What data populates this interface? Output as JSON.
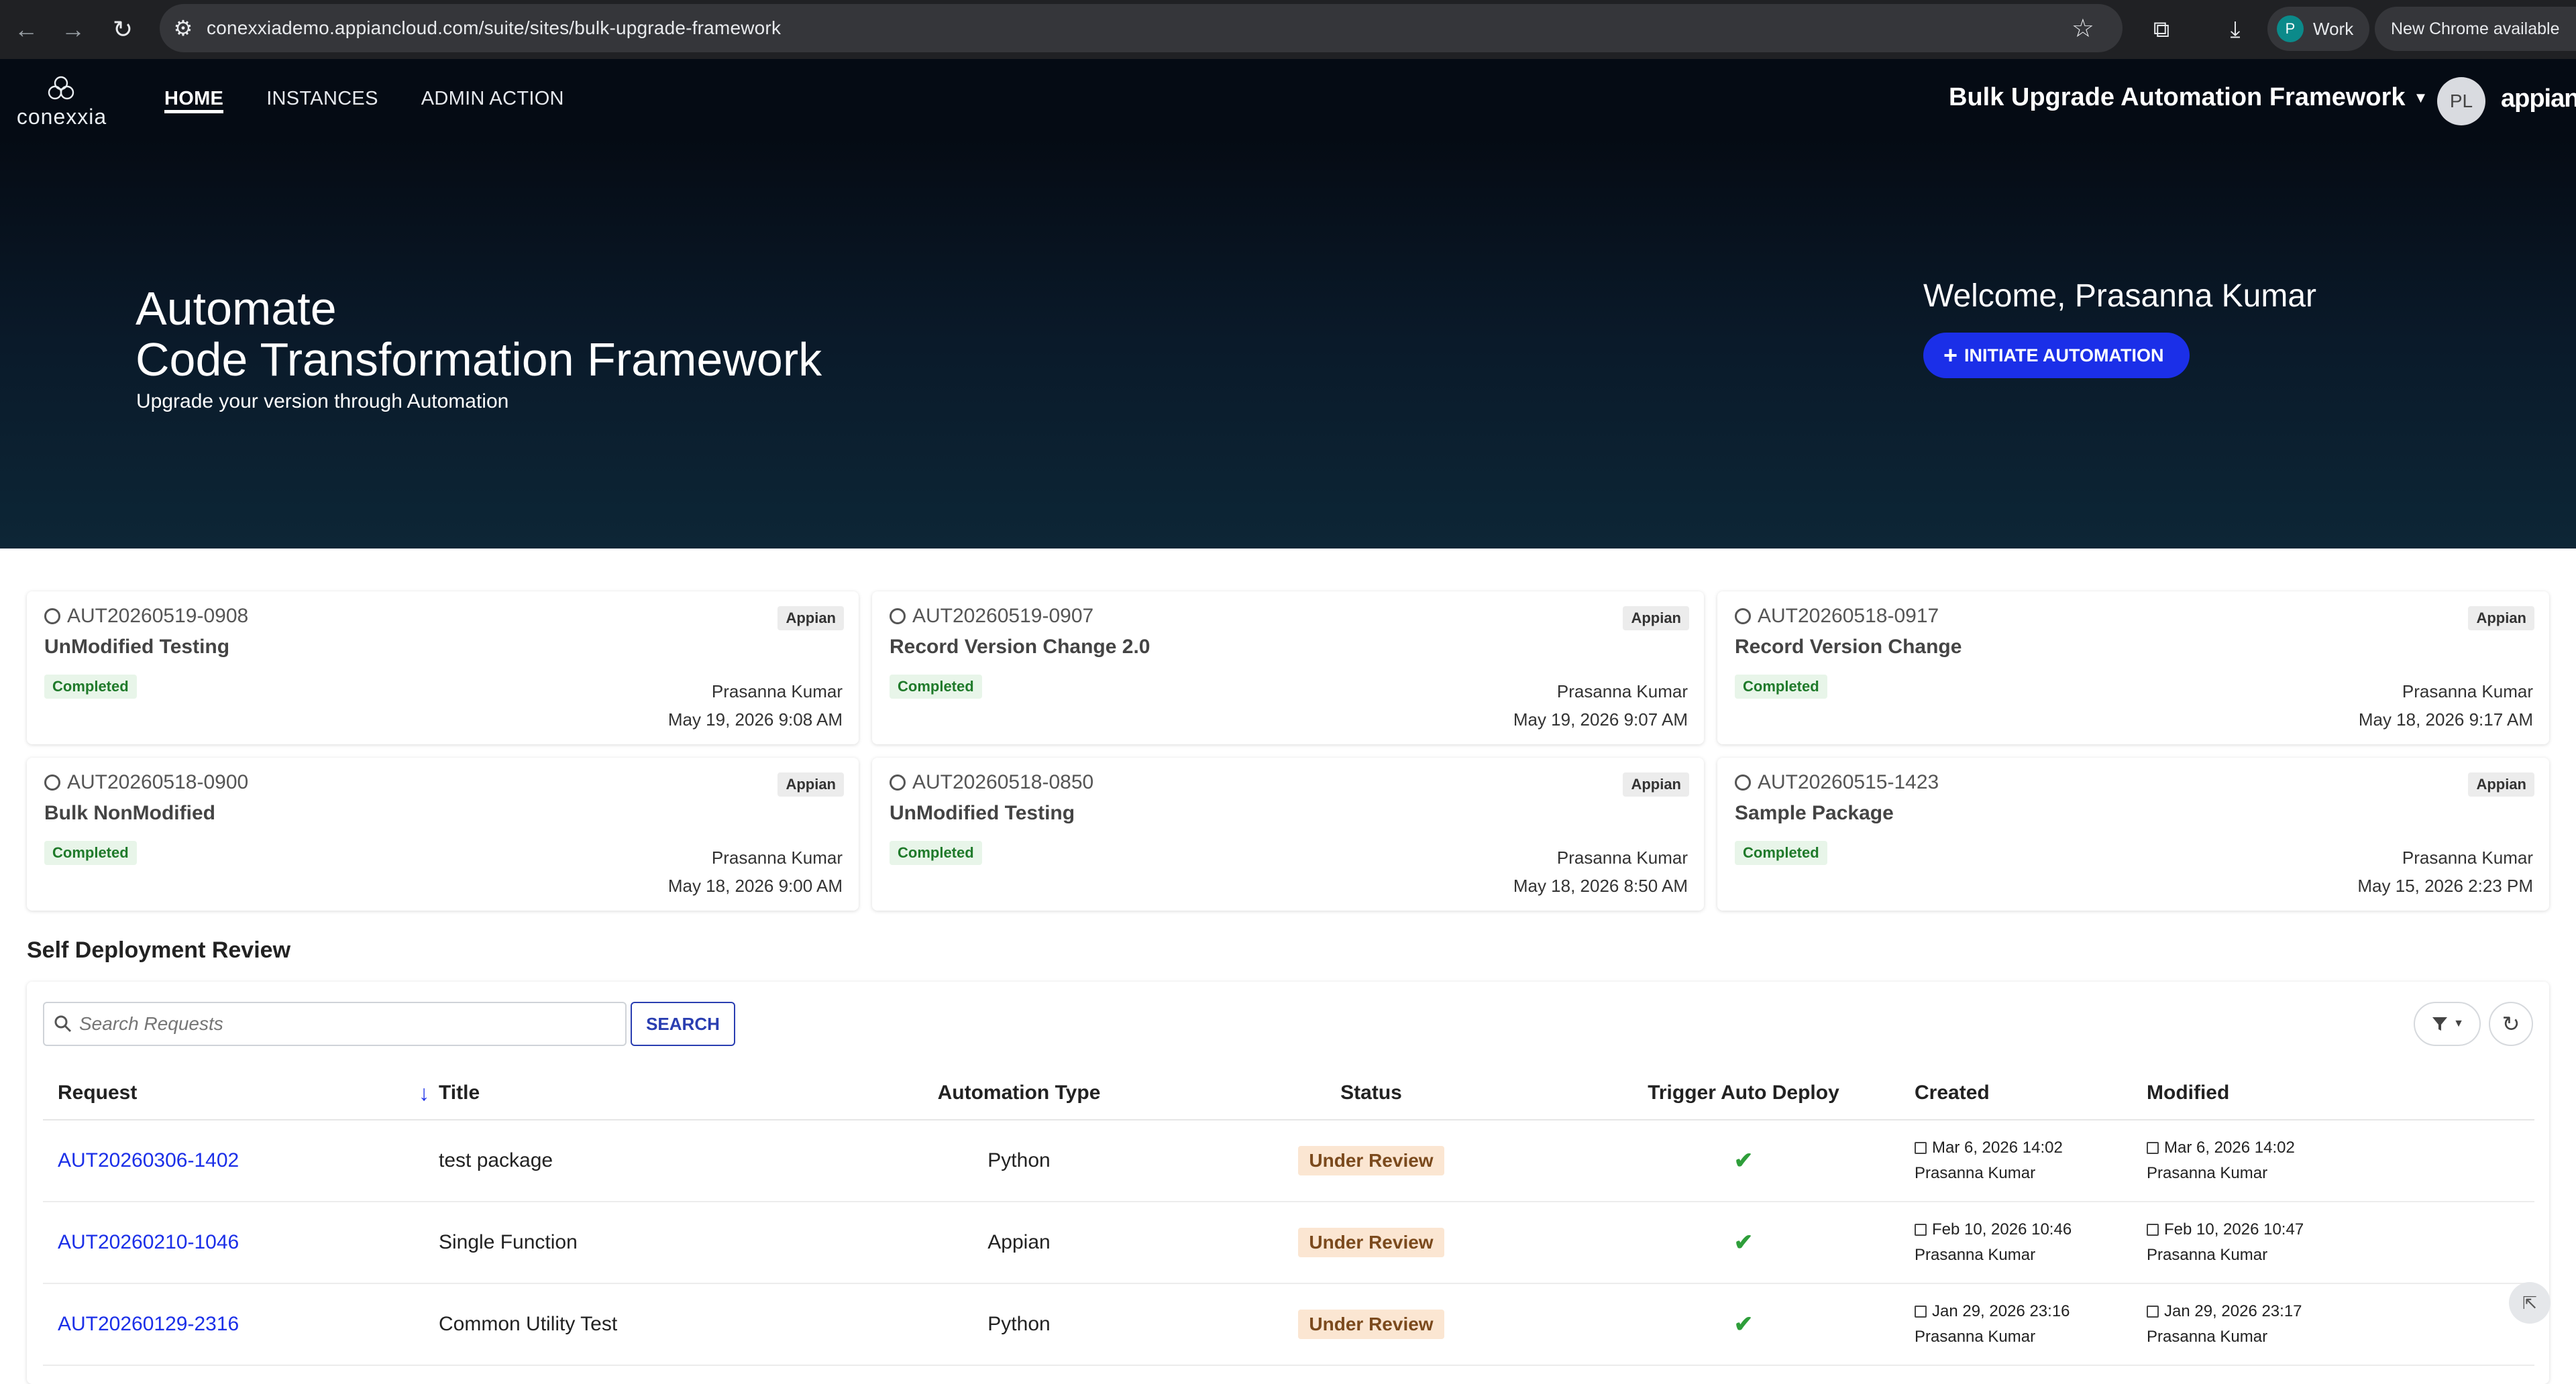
{
  "browser": {
    "url": "conexxiademo.appiancloud.com/suite/sites/bulk-upgrade-framework",
    "profile_initial": "P",
    "profile_label": "Work",
    "update_label": "New Chrome available"
  },
  "header": {
    "logo_text": "conexxia",
    "tabs": [
      {
        "label": "HOME",
        "active": true
      },
      {
        "label": "INSTANCES",
        "active": false
      },
      {
        "label": "ADMIN ACTION",
        "active": false
      }
    ],
    "app_name": "Bulk Upgrade Automation Framework",
    "user_initials": "PL",
    "brand_logo": "appian"
  },
  "hero": {
    "title_line1": "Automate",
    "title_line2": "Code Transformation Framework",
    "subtitle": "Upgrade your version through Automation",
    "welcome": "Welcome, Prasanna Kumar",
    "cta_label": "INITIATE AUTOMATION"
  },
  "cards": [
    {
      "id": "AUT20260519-0908",
      "title": "UnModified Testing",
      "tag": "Appian",
      "status": "Completed",
      "owner": "Prasanna Kumar",
      "date": "May 19, 2026 9:08 AM"
    },
    {
      "id": "AUT20260519-0907",
      "title": "Record Version Change 2.0",
      "tag": "Appian",
      "status": "Completed",
      "owner": "Prasanna Kumar",
      "date": "May 19, 2026 9:07 AM"
    },
    {
      "id": "AUT20260518-0917",
      "title": "Record Version Change",
      "tag": "Appian",
      "status": "Completed",
      "owner": "Prasanna Kumar",
      "date": "May 18, 2026 9:17 AM"
    },
    {
      "id": "AUT20260518-0900",
      "title": "Bulk NonModified",
      "tag": "Appian",
      "status": "Completed",
      "owner": "Prasanna Kumar",
      "date": "May 18, 2026 9:00 AM"
    },
    {
      "id": "AUT20260518-0850",
      "title": "UnModified Testing",
      "tag": "Appian",
      "status": "Completed",
      "owner": "Prasanna Kumar",
      "date": "May 18, 2026 8:50 AM"
    },
    {
      "id": "AUT20260515-1423",
      "title": "Sample Package",
      "tag": "Appian",
      "status": "Completed",
      "owner": "Prasanna Kumar",
      "date": "May 15, 2026 2:23 PM"
    }
  ],
  "review": {
    "section_title": "Self Deployment Review",
    "search_placeholder": "Search Requests",
    "search_button": "SEARCH",
    "columns": [
      "Request",
      "Title",
      "Automation Type",
      "Status",
      "Trigger Auto Deploy",
      "Created",
      "Modified"
    ],
    "rows": [
      {
        "request": "AUT20260306-1402",
        "title": "test package",
        "type": "Python",
        "status": "Under Review",
        "trigger": "✔",
        "created": "Mar 6, 2026 14:02",
        "created_by": "Prasanna Kumar",
        "modified": "Mar 6, 2026 14:02",
        "modified_by": "Prasanna Kumar"
      },
      {
        "request": "AUT20260210-1046",
        "title": "Single Function",
        "type": "Appian",
        "status": "Under Review",
        "trigger": "✔",
        "created": "Feb 10, 2026 10:46",
        "created_by": "Prasanna Kumar",
        "modified": "Feb 10, 2026 10:47",
        "modified_by": "Prasanna Kumar"
      },
      {
        "request": "AUT20260129-2316",
        "title": "Common Utility Test",
        "type": "Python",
        "status": "Under Review",
        "trigger": "✔",
        "created": "Jan 29, 2026 23:16",
        "created_by": "Prasanna Kumar",
        "modified": "Jan 29, 2026 23:17",
        "modified_by": "Prasanna Kumar"
      }
    ]
  },
  "colors": {
    "accent": "#1b2fe8",
    "header_bg": "#050b14",
    "completed": "#1f7a2a",
    "under_review_bg": "#fbe6d2"
  }
}
